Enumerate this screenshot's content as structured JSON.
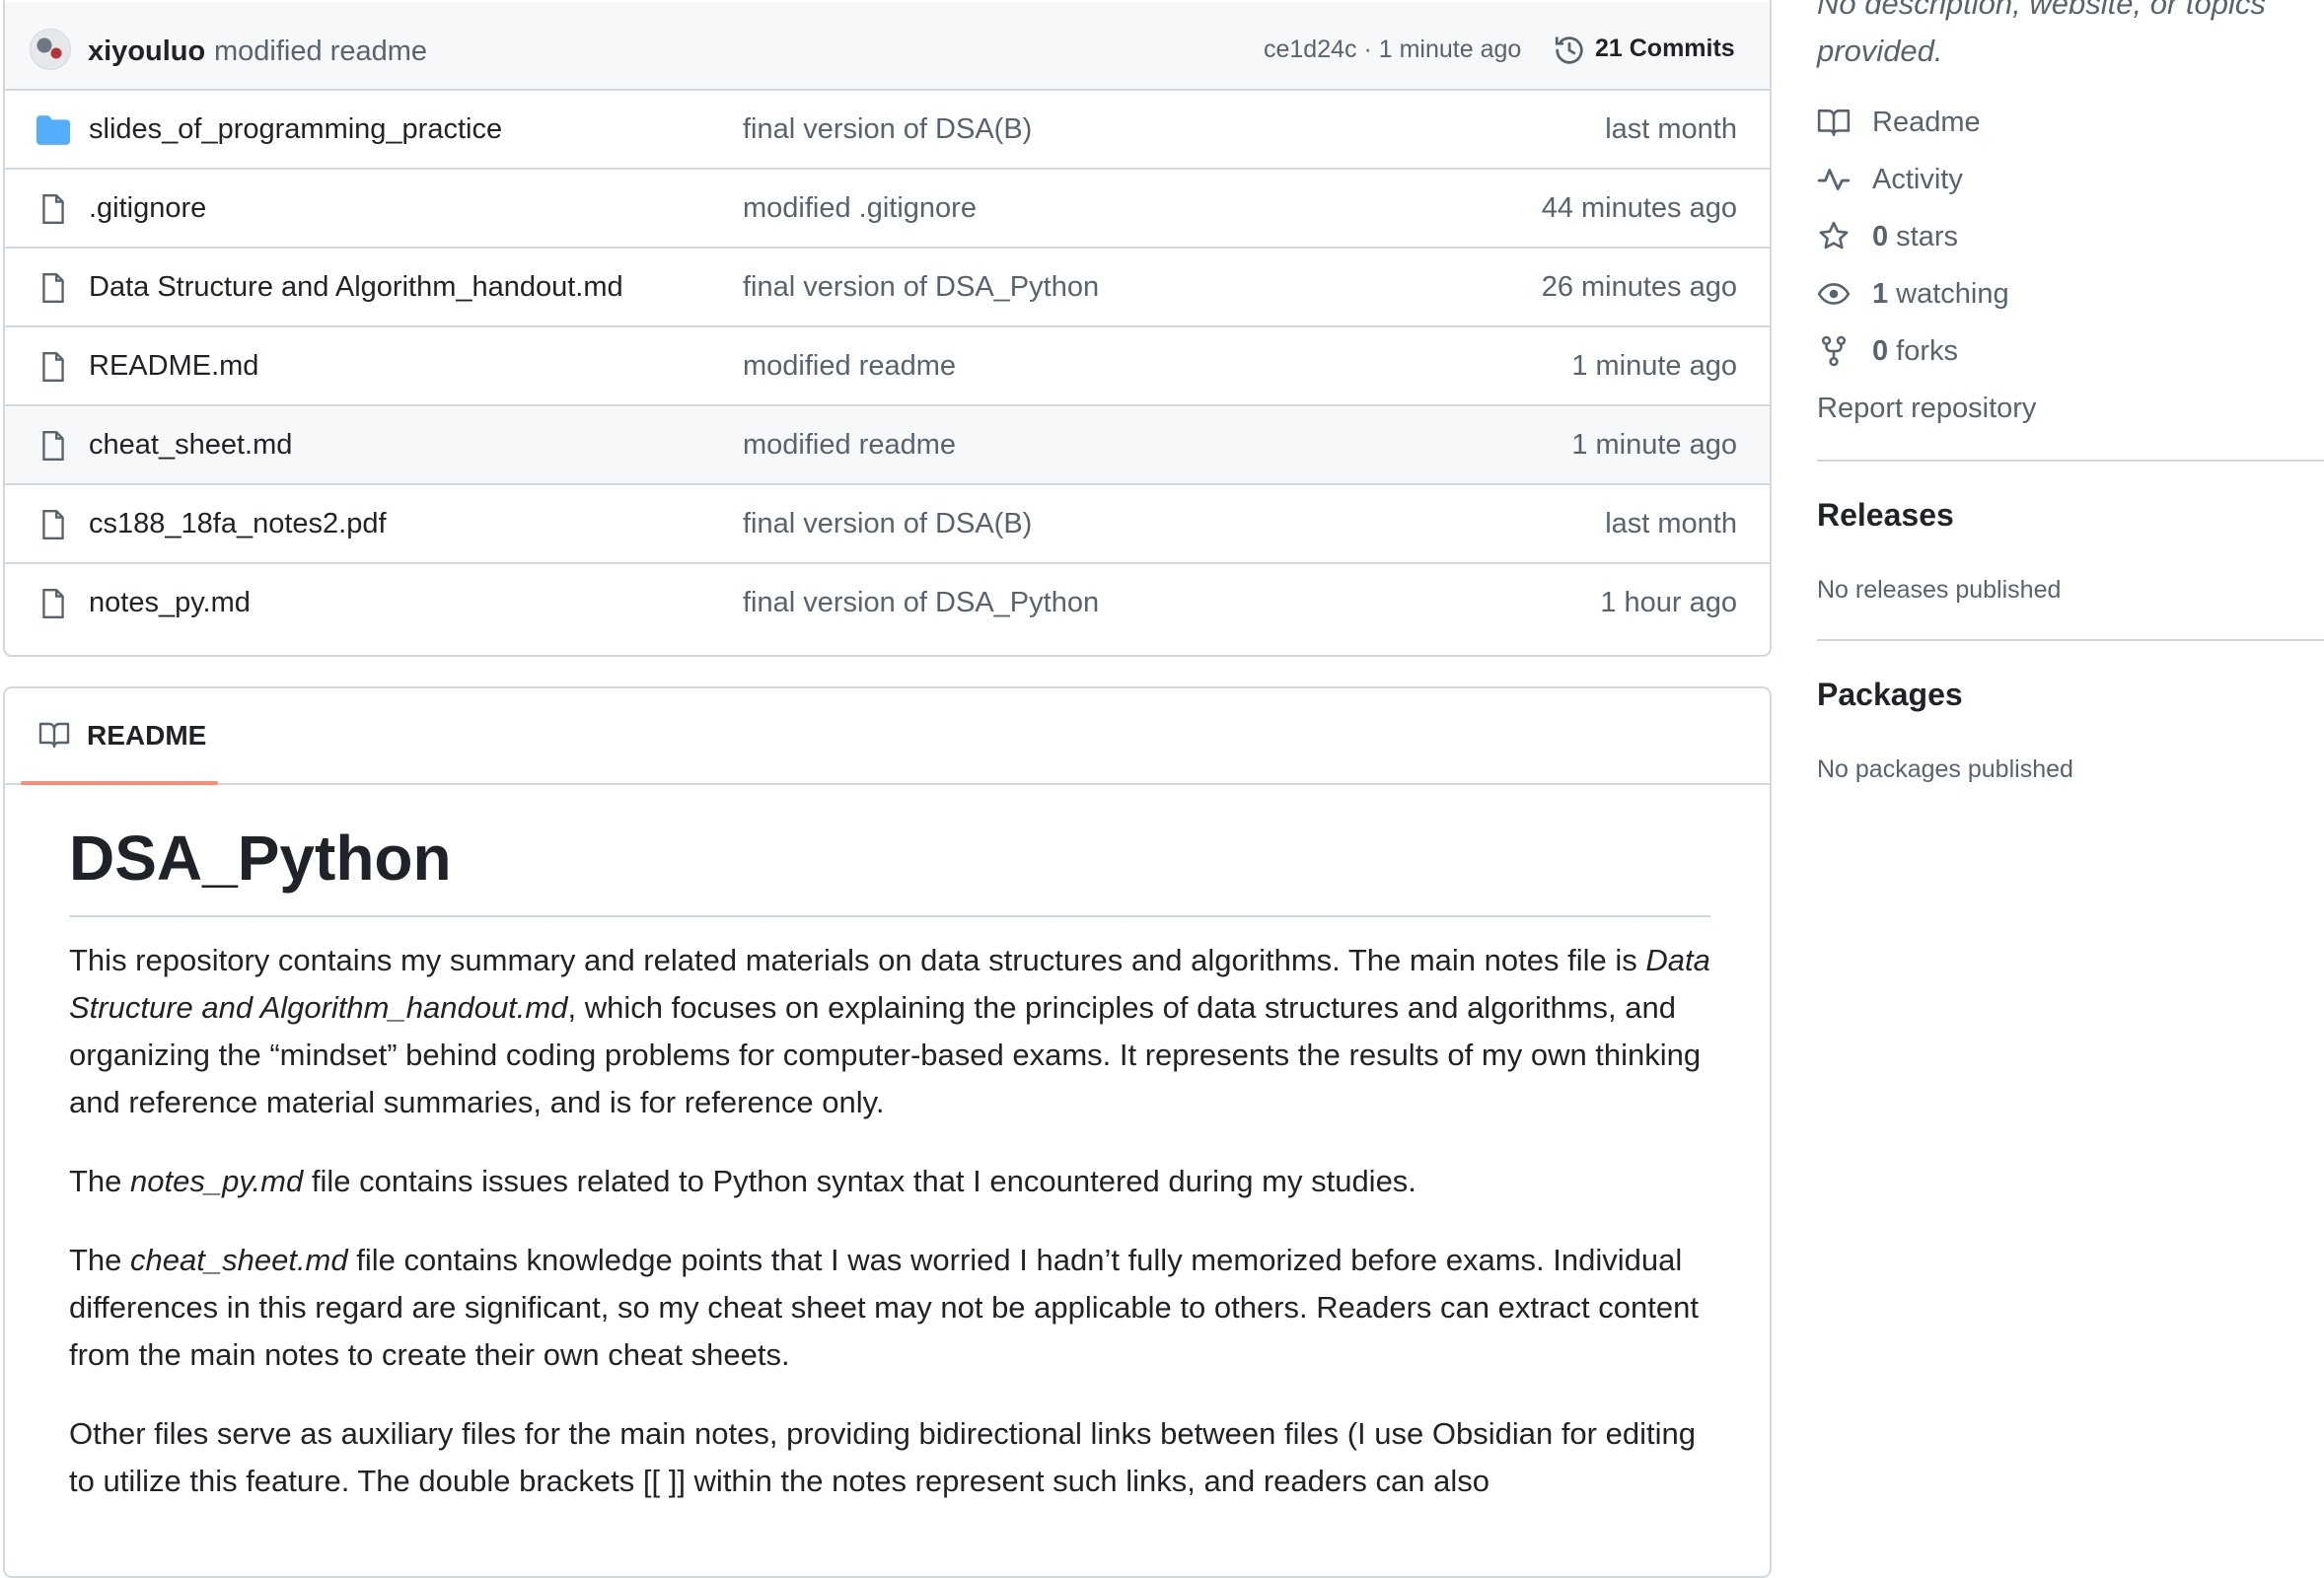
{
  "commit_bar": {
    "user": "xiyouluo",
    "message": "modified readme",
    "meta": "ce1d24c · 1 minute ago",
    "commits_label": "21 Commits"
  },
  "files": [
    {
      "name": "slides_of_programming_practice",
      "type": "folder",
      "commit": "final version of DSA(B)",
      "time": "last month"
    },
    {
      "name": ".gitignore",
      "type": "file",
      "commit": "modified .gitignore",
      "time": "44 minutes ago"
    },
    {
      "name": "Data Structure and Algorithm_handout.md",
      "type": "file",
      "commit": "final version of DSA_Python",
      "time": "26 minutes ago"
    },
    {
      "name": "README.md",
      "type": "file",
      "commit": "modified readme",
      "time": "1 minute ago"
    },
    {
      "name": "cheat_sheet.md",
      "type": "file",
      "commit": "modified readme",
      "time": "1 minute ago"
    },
    {
      "name": "cs188_18fa_notes2.pdf",
      "type": "file",
      "commit": "final version of DSA(B)",
      "time": "last month"
    },
    {
      "name": "notes_py.md",
      "type": "file",
      "commit": "final version of DSA_Python",
      "time": "1 hour ago"
    }
  ],
  "readme": {
    "tab_label": "README",
    "title": "DSA_Python",
    "p1_a": "This repository contains my summary and related materials on data structures and algorithms. The main notes file is ",
    "p1_em": "Data Structure and Algorithm_handout.md",
    "p1_b": ", which focuses on explaining the principles of data structures and algorithms, and organizing the “mindset” behind coding problems for computer-based exams. It represents the results of my own thinking and reference material summaries, and is for reference only.",
    "p2_a": "The ",
    "p2_em": "notes_py.md",
    "p2_b": " file contains issues related to Python syntax that I encountered during my studies.",
    "p3_a": "The ",
    "p3_em": "cheat_sheet.md",
    "p3_b": " file contains knowledge points that I was worried I hadn’t fully memorized before exams. Individual differences in this regard are significant, so my cheat sheet may not be applicable to others. Readers can extract content from the main notes to create their own cheat sheets.",
    "p4": "Other files serve as auxiliary files for the main notes, providing bidirectional links between files (I use Obsidian for editing to utilize this feature. The double brackets [[ ]] within the notes represent such links, and readers can also"
  },
  "sidebar": {
    "description": "No description, website, or topics provided.",
    "readme_label": "Readme",
    "activity_label": "Activity",
    "stars_count": "0",
    "stars_label": "stars",
    "watching_count": "1",
    "watching_label": "watching",
    "forks_count": "0",
    "forks_label": "forks",
    "report_label": "Report repository",
    "releases_heading": "Releases",
    "releases_note": "No releases published",
    "packages_heading": "Packages",
    "packages_note": "No packages published"
  },
  "colors": {
    "accent_underline": "#fd8c73",
    "folder_blue": "#54aeff",
    "muted_text": "#59636e",
    "border": "#d1d9e0"
  }
}
